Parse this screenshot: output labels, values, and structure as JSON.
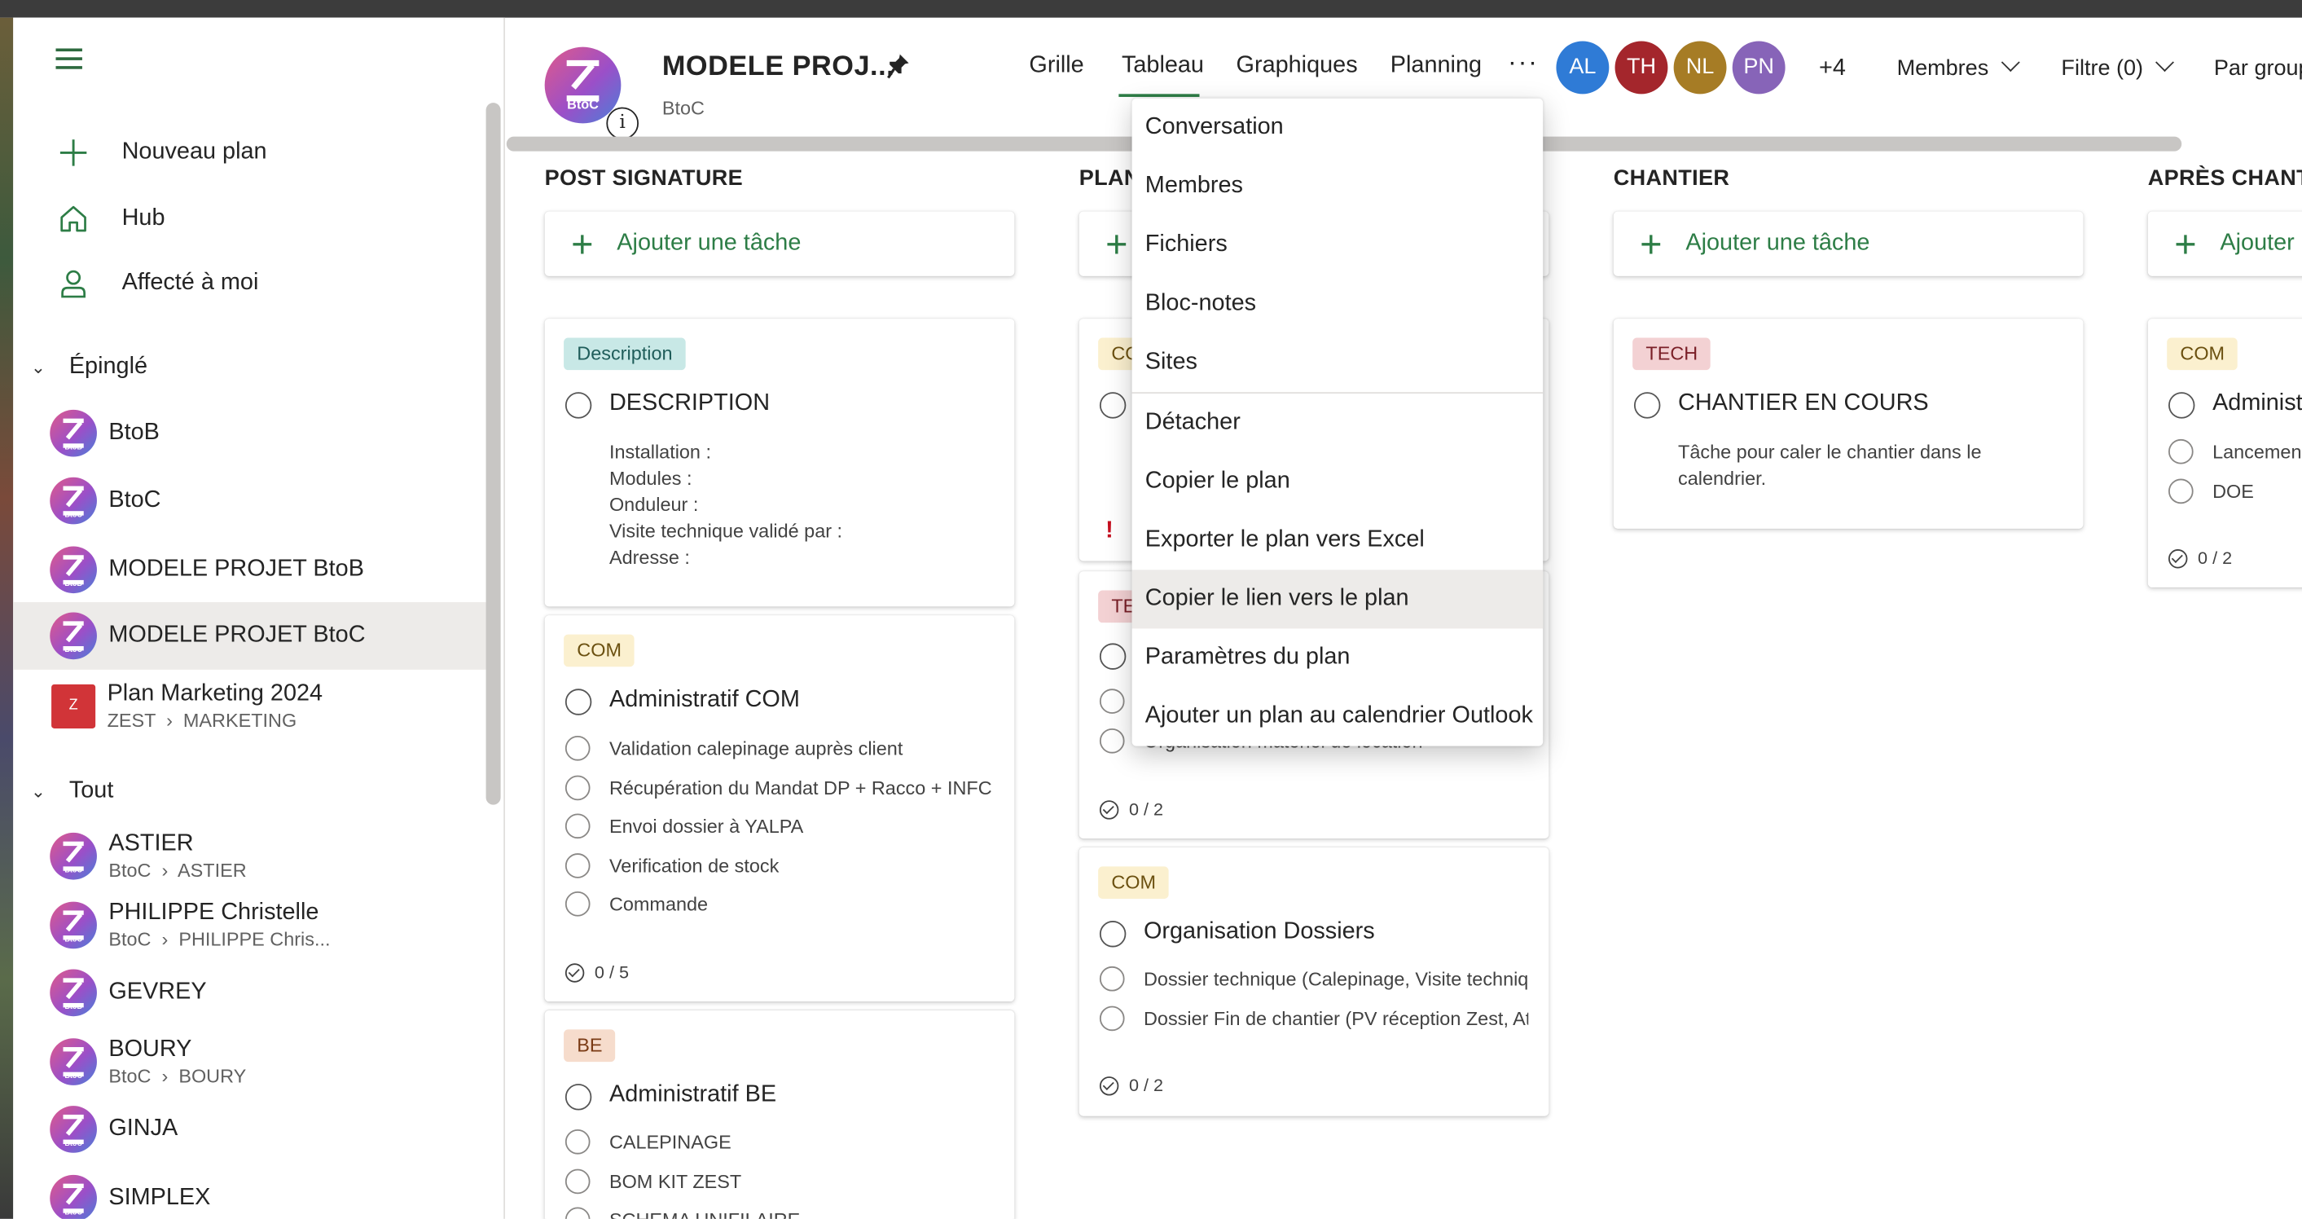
{
  "sidebar": {
    "menu_icon": "hamburger-icon",
    "actions": [
      {
        "label": "Nouveau plan",
        "icon": "plus-icon"
      },
      {
        "label": "Hub",
        "icon": "home-icon"
      },
      {
        "label": "Affecté à moi",
        "icon": "person-icon"
      }
    ],
    "pinned_heading": "Épinglé",
    "pinned": [
      {
        "name": "BtoB",
        "badge": "BtoB"
      },
      {
        "name": "BtoC",
        "badge": "BtoC"
      },
      {
        "name": "MODELE PROJET BtoB",
        "badge": "BtoB"
      },
      {
        "name": "MODELE PROJET BtoC",
        "badge": "BtoC",
        "selected": true
      },
      {
        "name": "Plan Marketing 2024",
        "badge": "Z",
        "path1": "ZEST",
        "path2": "MARKETING"
      }
    ],
    "all_heading": "Tout",
    "all": [
      {
        "name": "ASTIER",
        "badge": "BtoC",
        "path1": "BtoC",
        "path2": "ASTIER"
      },
      {
        "name": "PHILIPPE Christelle",
        "badge": "BtoC",
        "path1": "BtoC",
        "path2": "PHILIPPE Chris..."
      },
      {
        "name": "GEVREY",
        "badge": "BtoB"
      },
      {
        "name": "BOURY",
        "badge": "BtoC",
        "path1": "BtoC",
        "path2": "BOURY"
      },
      {
        "name": "GINJA",
        "badge": "BtoC"
      },
      {
        "name": "SIMPLEX",
        "badge": "BtoC"
      }
    ]
  },
  "header": {
    "logo_text": "BtoC",
    "title": "MODELE PROJ...",
    "subtitle": "BtoC",
    "info_label": "i",
    "tabs": [
      "Grille",
      "Tableau",
      "Graphiques",
      "Planning"
    ],
    "active_tab": "Tableau",
    "more_label": "···",
    "members": [
      {
        "initials": "AL",
        "color": "#2f7bd6"
      },
      {
        "initials": "TH",
        "color": "#a4262c"
      },
      {
        "initials": "NL",
        "color": "#a67c25"
      },
      {
        "initials": "PN",
        "color": "#8764b8"
      }
    ],
    "extra_members": "+4",
    "members_button": "Membres",
    "filter_button": "Filtre (0)",
    "group_button": "Par group"
  },
  "menu": {
    "items": [
      "Conversation",
      "Membres",
      "Fichiers",
      "Bloc-notes",
      "Sites",
      "Détacher",
      "Copier le plan",
      "Exporter le plan vers Excel",
      "Copier le lien vers le plan",
      "Paramètres du plan",
      "Ajouter un plan au calendrier Outlook"
    ],
    "hovered": "Copier le lien vers le plan"
  },
  "board": {
    "add_task_label": "Ajouter une tâche",
    "add_task_partial": "Ajouter",
    "buckets": [
      "POST SIGNATURE",
      "PLAN",
      "CHANTIER",
      "APRÈS CHANTI"
    ],
    "cards": {
      "description": {
        "tag": "Description",
        "title": "DESCRIPTION",
        "lines": [
          "Installation :",
          "Modules :",
          "Onduleur :",
          "Visite technique validé par :",
          "Adresse :"
        ]
      },
      "admin_com": {
        "tag": "COM",
        "title": "Administratif COM",
        "checklist": [
          "Validation calepinage auprès client",
          "Récupération du Mandat DP + Racco + INFC",
          "Envoi dossier à YALPA",
          "Verification de stock",
          "Commande"
        ],
        "progress": "0 / 5"
      },
      "admin_be": {
        "tag": "BE",
        "title": "Administratif BE",
        "checklist": [
          "CALEPINAGE",
          "BOM KIT ZEST",
          "SCHEMA UNIFILAIRE"
        ]
      },
      "plan_card1": {
        "tag": "CO",
        "urgent": "!"
      },
      "plan_card2": {
        "tag": "TE",
        "checklist_partial": "Organisation matériel de location",
        "progress": "0 / 2"
      },
      "organisation": {
        "tag": "COM",
        "title": "Organisation Dossiers",
        "checklist": [
          "Dossier technique (Calepinage, Visite techniq",
          "Dossier Fin de chantier (PV réception Zest, At"
        ],
        "progress": "0 / 2"
      },
      "chantier": {
        "tag": "TECH",
        "title": "CHANTIER EN COURS",
        "description": "Tâche pour caler le chantier dans le\ncalendrier."
      },
      "apres": {
        "tag": "COM",
        "title": "Administ",
        "checklist": [
          "Lancemen",
          "DOE"
        ],
        "progress": "0 / 2"
      }
    }
  }
}
